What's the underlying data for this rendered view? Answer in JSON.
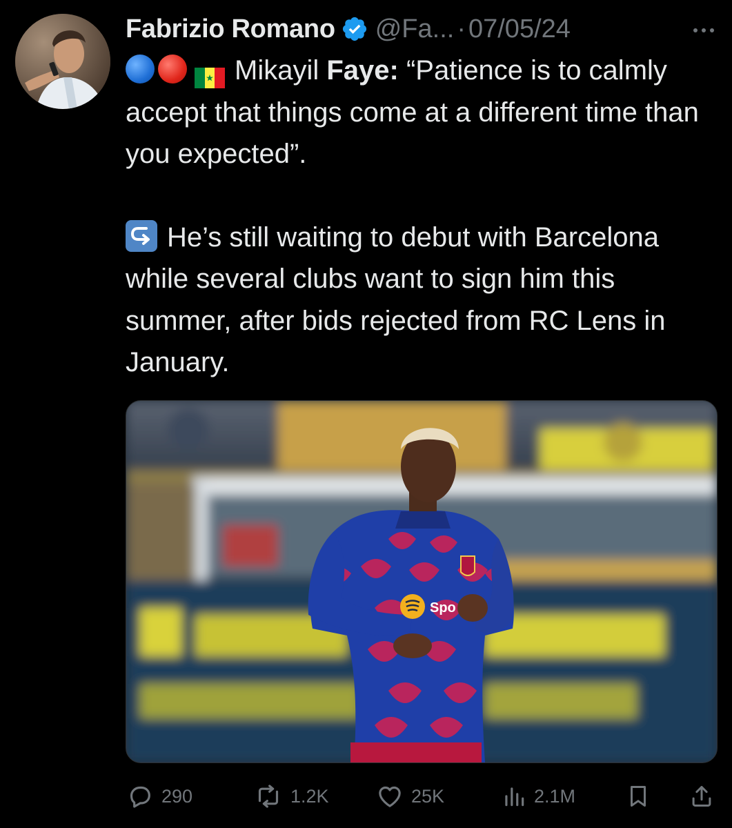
{
  "tweet": {
    "author": {
      "name": "Fabrizio Romano",
      "handle": "@Fa...",
      "verified": true,
      "verified_color": "#1d9bf0"
    },
    "separator": "·",
    "date": "07/05/24",
    "more_icon": "more-horizontal-icon",
    "text": {
      "line1_emojis": [
        "blue-circle",
        "red-circle",
        "senegal-flag"
      ],
      "name_plain": "Mikayil",
      "name_bold": "Faye:",
      "quote": "“Patience is to calmly accept that things come at a different time than you expected”.",
      "paragraph2_emoji": "right-arrow-curving-left",
      "paragraph2": "He’s still waiting to debut with Barcelona while several clubs want to sign him this summer, after bids rejected from RC Lens in January."
    },
    "media": {
      "description_icon": "photo-image",
      "jersey_sponsor": "Spo"
    },
    "stats": {
      "replies": "290",
      "reposts": "1.2K",
      "likes": "25K",
      "views": "2.1M"
    },
    "colors": {
      "background": "#000000",
      "text": "#e7e9ea",
      "secondary": "#71767b"
    }
  }
}
